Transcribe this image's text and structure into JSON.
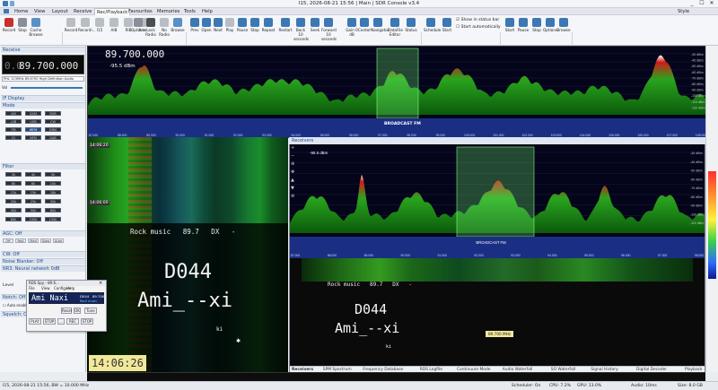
{
  "window": {
    "title": "I15, 2026-08-21 15:56 | Main | SDR Console v3.4",
    "controls": [
      "_",
      "☐",
      "✕"
    ],
    "style_label": "Style"
  },
  "menu": [
    "Home",
    "View",
    "Layout",
    "Receive",
    "Rec/Playback",
    "Favourites",
    "Memories",
    "Tools",
    "Help"
  ],
  "menu_active": "Rec/Playback",
  "ribbon": {
    "buttons": [
      {
        "label": "Record",
        "color": "#c9302c"
      },
      {
        "label": "Stop",
        "color": "#8a8f96"
      },
      {
        "label": "Cache Browse",
        "color": "#5b8fc7"
      },
      {
        "label": "Record",
        "color": "#b9bec4"
      },
      {
        "label": "Recordi...",
        "color": "#b9bec4"
      },
      {
        "label": "I15",
        "color": "#b9bec4"
      },
      {
        "label": "AIB",
        "color": "#b9bec4"
      },
      {
        "label": "RIB",
        "color": "#b9bec4"
      },
      {
        "label": "Arcs",
        "color": "#b9bec4"
      },
      {
        "label": "Options",
        "color": "#8a8f96"
      },
      {
        "label": "Lock Radio",
        "color": "#4a4f56"
      },
      {
        "label": "No Radio",
        "color": "#b9bec4"
      },
      {
        "label": "Browse",
        "color": "#5b8fc7"
      },
      {
        "label": "Prev",
        "color": "#3c78b4"
      },
      {
        "label": "Open",
        "color": "#3c78b4"
      },
      {
        "label": "Next",
        "color": "#3c78b4"
      },
      {
        "label": "Play",
        "color": "#b9bec4"
      },
      {
        "label": "Pause",
        "color": "#3c78b4"
      },
      {
        "label": "Stop",
        "color": "#3c78b4"
      },
      {
        "label": "Repeat",
        "color": "#3c78b4"
      },
      {
        "label": "Restart",
        "color": "#3c78b4"
      },
      {
        "label": "Back 10 seconds",
        "color": "#3c78b4"
      },
      {
        "label": "Seek",
        "color": "#3c78b4"
      },
      {
        "label": "Forward 10 seconds",
        "color": "#3c78b4"
      },
      {
        "label": "Gain 0 dB",
        "color": "#3c78b4"
      },
      {
        "label": "Center",
        "color": "#3c78b4"
      },
      {
        "label": "Navigator",
        "color": "#3c78b4"
      },
      {
        "label": "DataFile Editor",
        "color": "#3c78b4"
      },
      {
        "label": "Status",
        "color": "#3c78b4"
      },
      {
        "label": "Schedule",
        "color": "#3c78b4"
      },
      {
        "label": "Start",
        "color": "#3c78b4"
      }
    ],
    "checks": [
      "Show in status bar",
      "Start automatically"
    ],
    "video_buttons": [
      "Start",
      "Pause",
      "Stop",
      "Options",
      "Browse"
    ],
    "groups": [
      "Audio",
      "Data - Record",
      "Data - Playback",
      "Data - Scheduler",
      "Video"
    ]
  },
  "receive": {
    "header": "Receive",
    "frequency": "89.700.000",
    "freq_prefix": "0.0",
    "mode_label": "PHL 123MHz 89.6700 High Definition Audio",
    "sections": [
      "IF Display",
      "Mode",
      "Filter",
      "AGC: Off",
      "CW: Off",
      "Noise Blanker: Off",
      "NR3: Neural network 0dB",
      "Notch: Off",
      "Squelch: Off"
    ],
    "mode_buttons": [
      "AM",
      "SAM",
      "DSB",
      "LSB",
      "USB",
      "CW",
      "FM",
      "WFM",
      "DRM",
      "IQ",
      "NFM",
      "DAB"
    ],
    "filter_buttons": [
      "3k",
      "4k",
      "5k",
      "6k",
      "8k",
      "10k",
      "12k",
      "15k",
      "18k",
      "20k",
      "25k",
      "30k",
      "40k",
      "50k",
      "60k",
      "80k",
      "100k",
      "150k"
    ],
    "agc_buttons": [
      "Off",
      "Fast",
      "Med",
      "Slow",
      "Auto"
    ],
    "level_label": "Level",
    "auto_label": "Auto enable"
  },
  "spectrum": {
    "freq_display": "89.700.000",
    "level_readout": "-95.5 dBm",
    "band_label": "BROADCAST FM",
    "db_labels": [
      "-30 dBm",
      "-40 dBm",
      "-50 dBm",
      "-60 dBm",
      "-70 dBm",
      "-80 dBm",
      "-90 dBm",
      "-100 dBm",
      "-110 dBm",
      "-120 dBm"
    ],
    "freq_ticks": [
      "87.000",
      "88.000",
      "89.000",
      "90.000",
      "91.000",
      "92.000",
      "93.000",
      "94.000",
      "95.000",
      "96.000",
      "97.000",
      "98.000",
      "99.000",
      "100.000",
      "101.000",
      "102.000",
      "103.000",
      "104.000",
      "105.000",
      "106.000",
      "107.000",
      "108.000"
    ]
  },
  "waterfall": {
    "time_top": "14:06:20",
    "time_mid": "14:06:00",
    "rds_text": "Rock music   89.7   DX   -",
    "ps_name": "D044",
    "radiotext": "Ami_--xi",
    "small_text": "ki",
    "clock": "14:06:26"
  },
  "receivers": {
    "header": "Receivers",
    "level_readout": "-95.5 dBm",
    "band_label": "BROADCAST FM",
    "rds_text": "Rock music   89.7   DX   -",
    "ps_name": "D044",
    "radiotext": "Ami_--xi",
    "small_text": "ki",
    "marker": "89.700 MHz",
    "tabs": [
      "Receivers",
      "SPM Spectrum",
      "Frequency Database",
      "RDS Logfile",
      "Continuum Mode",
      "Audio Waterfall",
      "SO Waterfall",
      "Signal History",
      "Digital Decoder",
      "Playback"
    ]
  },
  "rds_popup": {
    "title": "RDS Spy - 89.6...",
    "menu": [
      "File",
      "View",
      "Configure",
      "Help"
    ],
    "ps": "Ami Naxi",
    "pi": "D044",
    "freq": "89.700",
    "sub": "Rock music",
    "buttons": [
      "Reset",
      "OK",
      "Tune",
      "PLAY",
      "STOP",
      "...",
      "REC",
      "STOP"
    ]
  },
  "status": {
    "left": "I15, 2026-08-21 15:56, BW = 10.000 MHz",
    "scheduler": "Scheduler: On",
    "cpu": "CPU: 7.2%",
    "gpu": "GPU: 13.0%",
    "audio": "Audio: 10ms",
    "size": "Size: 8.0 GB"
  },
  "colors": {
    "accent": "#1d4c8b",
    "spectrum_bg": "#04041a",
    "signal_green": "#1aa31a",
    "signal_red": "#c81818",
    "band_bar": "#1a2f84",
    "selection": "#4caf50"
  }
}
